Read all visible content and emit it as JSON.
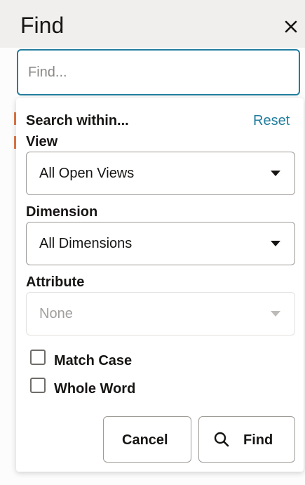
{
  "header": {
    "title": "Find",
    "close_icon": "close-icon"
  },
  "search": {
    "placeholder": "Find...",
    "value": ""
  },
  "panel": {
    "section_label": "Search within...",
    "reset_label": "Reset",
    "view": {
      "label": "View",
      "selected": "All Open Views"
    },
    "dimension": {
      "label": "Dimension",
      "selected": "All Dimensions"
    },
    "attribute": {
      "label": "Attribute",
      "selected": "None",
      "disabled": true
    },
    "options": {
      "match_case": {
        "label": "Match Case",
        "checked": false
      },
      "whole_word": {
        "label": "Whole Word",
        "checked": false
      }
    },
    "buttons": {
      "cancel": "Cancel",
      "find": "Find",
      "find_icon": "search-icon"
    }
  },
  "colors": {
    "accent": "#227e9e",
    "header_bg": "#f1efed",
    "text": "#161513",
    "disabled_text": "#a19f9c"
  }
}
